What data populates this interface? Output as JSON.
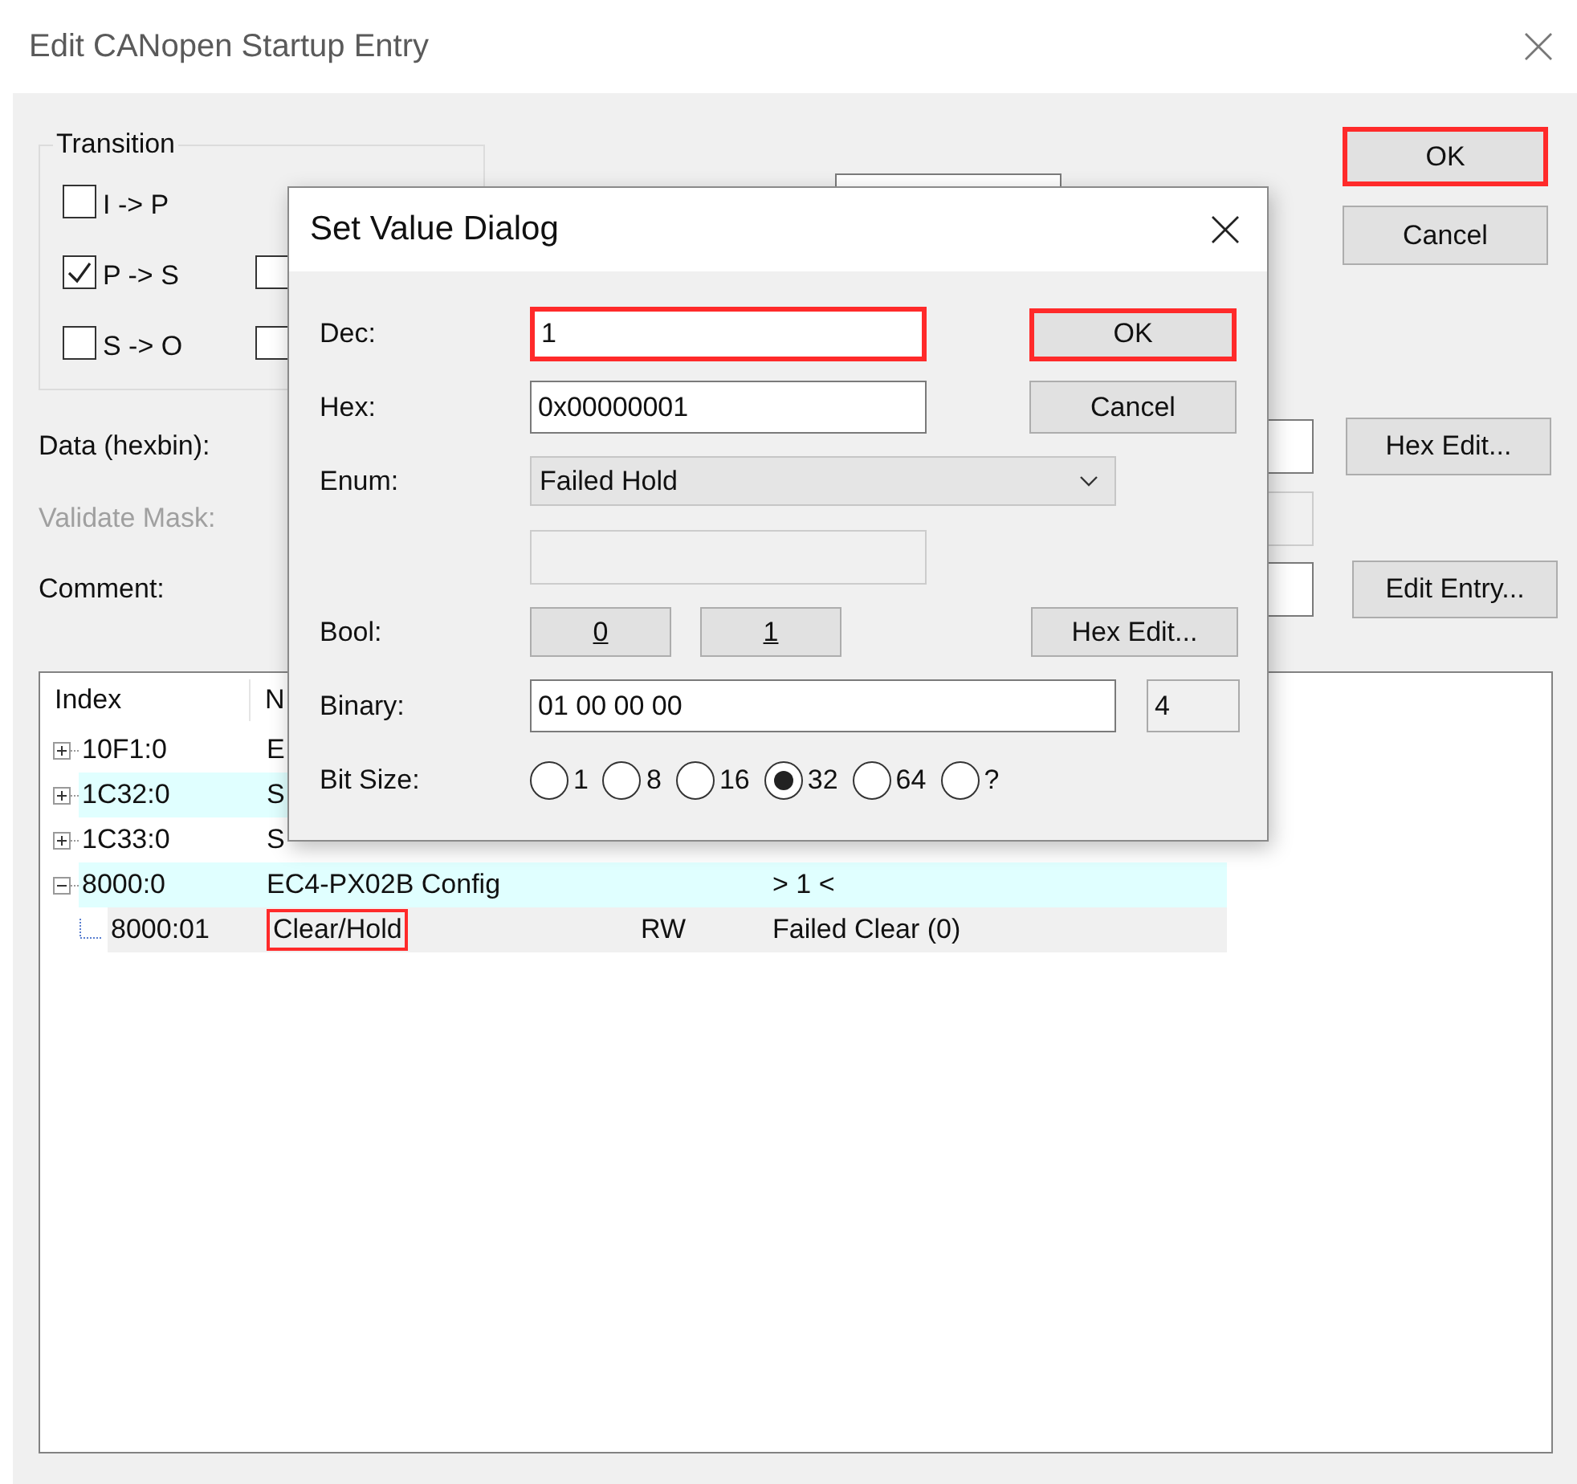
{
  "window": {
    "title": "Edit CANopen Startup Entry"
  },
  "transition": {
    "title": "Transition",
    "checkboxes": [
      {
        "label": "I -> P",
        "checked": false
      },
      {
        "label": "P -> S",
        "checked": true
      },
      {
        "label": "S -> O",
        "checked": false
      }
    ],
    "covered_checkboxes": [
      {
        "checked": false
      },
      {
        "checked": false
      }
    ]
  },
  "buttons": [
    {
      "label": "OK",
      "highlighted": true
    },
    {
      "label": "Cancel",
      "highlighted": false
    }
  ],
  "fields": [
    {
      "label": "Data (hexbin):",
      "disabled": false,
      "button": "Hex Edit..."
    },
    {
      "label": "Validate Mask:",
      "disabled": true
    },
    {
      "label": "Comment:",
      "disabled": false,
      "button": "Edit Entry..."
    }
  ],
  "tree": {
    "columns": [
      "Index",
      "N"
    ],
    "rows": [
      {
        "index": "10F1:0",
        "name": "E",
        "expanded": false,
        "tinted": false,
        "selected": false
      },
      {
        "index": "1C32:0",
        "name": "S",
        "expanded": false,
        "tinted": true,
        "selected": false
      },
      {
        "index": "1C33:0",
        "name": "S",
        "expanded": false,
        "tinted": false,
        "selected": false
      },
      {
        "index": "8000:0",
        "name": "EC4-PX02B Config",
        "value": "> 1 <",
        "expanded": true,
        "tinted": true,
        "selected": false,
        "children": [
          {
            "index": "8000:01",
            "name": "Clear/Hold",
            "access": "RW",
            "value": "Failed Clear (0)",
            "tinted": false,
            "selected": true,
            "highlighted": true
          }
        ]
      }
    ]
  },
  "dialog": {
    "title": "Set Value Dialog",
    "dec": {
      "label": "Dec:",
      "value": "1",
      "highlighted": true
    },
    "hex": {
      "label": "Hex:",
      "value": "0x00000001"
    },
    "enum": {
      "label": "Enum:",
      "value": "Failed Hold"
    },
    "bool": {
      "label": "Bool:",
      "buttons": [
        "0",
        "1"
      ]
    },
    "binary": {
      "label": "Binary:",
      "value": "01 00 00 00",
      "size": "4"
    },
    "bit_size": {
      "label": "Bit Size:",
      "options": [
        {
          "label": "1",
          "selected": false
        },
        {
          "label": "8",
          "selected": false
        },
        {
          "label": "16",
          "selected": false
        },
        {
          "label": "32",
          "selected": true
        },
        {
          "label": "64",
          "selected": false
        },
        {
          "label": "?",
          "selected": false
        }
      ]
    },
    "buttons": [
      {
        "label": "OK",
        "highlighted": true
      },
      {
        "label": "Cancel",
        "highlighted": false
      },
      {
        "label": "Hex Edit...",
        "highlighted": false
      }
    ]
  }
}
